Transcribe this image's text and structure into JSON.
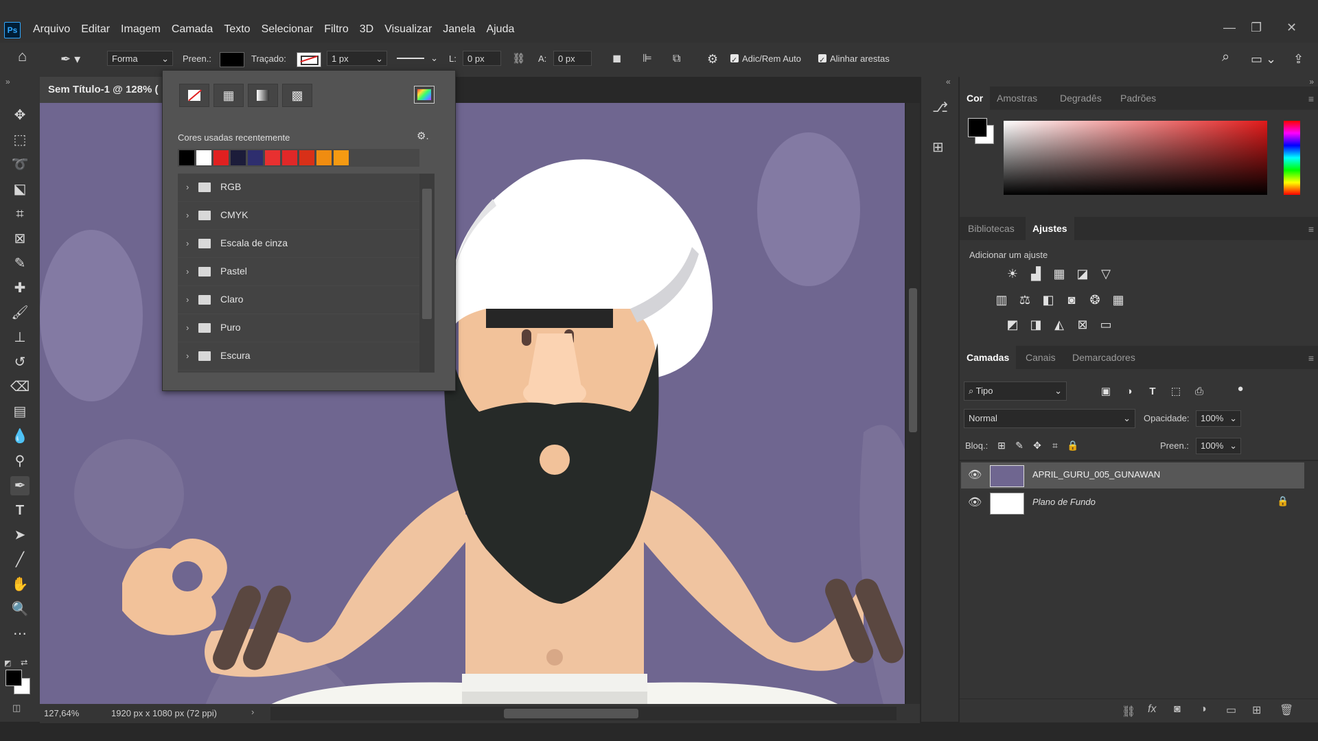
{
  "app": {
    "logo": "Ps"
  },
  "menu": [
    "Arquivo",
    "Editar",
    "Imagem",
    "Camada",
    "Texto",
    "Selecionar",
    "Filtro",
    "3D",
    "Visualizar",
    "Janela",
    "Ajuda"
  ],
  "options": {
    "mode": "Forma",
    "fill_label": "Preen.:",
    "stroke_label": "Traçado:",
    "stroke_width": "1 px",
    "w_label": "L:",
    "w_value": "0 px",
    "h_label": "A:",
    "h_value": "0 px",
    "auto_add_delete": "Adic/Rem Auto",
    "align_edges": "Alinhar arestas"
  },
  "document": {
    "tab_title": "Sem Título-1 @ 128% (",
    "zoom": "127,64%",
    "doc_info": "1920 px x 1080 px (72 ppi)"
  },
  "popup": {
    "recent_label": "Cores usadas recentemente",
    "recent_colors": [
      "#000000",
      "#ffffff",
      "#e02020",
      "#1c1c3a",
      "#2e2e6e",
      "#e83030",
      "#e02828",
      "#d83018",
      "#f08c10",
      "#f59a12"
    ],
    "folders": [
      "RGB",
      "CMYK",
      "Escala de cinza",
      "Pastel",
      "Claro",
      "Puro",
      "Escura"
    ]
  },
  "color_panel": {
    "tabs": [
      "Cor",
      "Amostras",
      "Degradês",
      "Padrões"
    ],
    "active": "Cor"
  },
  "adjust_panel": {
    "tabs": [
      "Bibliotecas",
      "Ajustes"
    ],
    "active": "Ajustes",
    "label": "Adicionar um ajuste"
  },
  "layers_panel": {
    "tabs": [
      "Camadas",
      "Canais",
      "Demarcadores"
    ],
    "active": "Camadas",
    "filter": "Tipo",
    "blend_mode": "Normal",
    "opacity_label": "Opacidade:",
    "opacity_value": "100%",
    "lock_label": "Bloq.:",
    "fill_label": "Preen.:",
    "fill_value": "100%",
    "layers": [
      {
        "name": "APRIL_GURU_005_GUNAWAN",
        "selected": true
      },
      {
        "name": "Plano de Fundo",
        "selected": false,
        "locked": true
      }
    ]
  }
}
